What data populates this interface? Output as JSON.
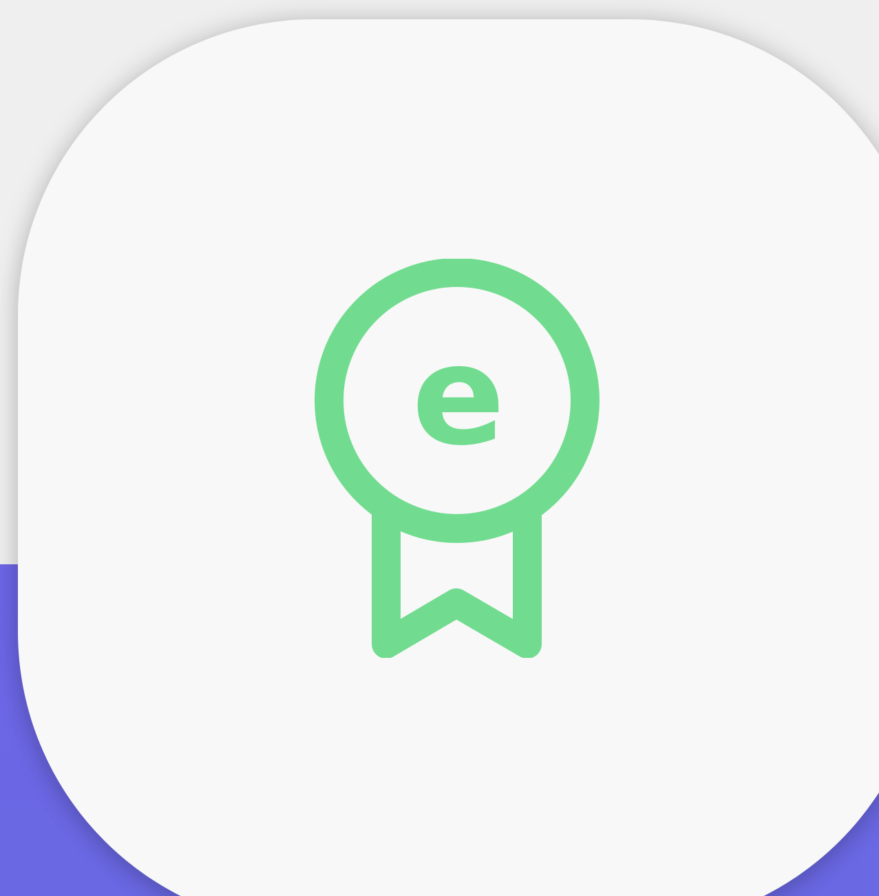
{
  "app_icon": {
    "icon": "award-badge-icon",
    "badge_letter": "e",
    "colors": {
      "accent_green": "#71dc8f",
      "tile_background": "#f8f8f8",
      "band_purple": "#6d66e8",
      "page_background": "#efefef"
    }
  }
}
